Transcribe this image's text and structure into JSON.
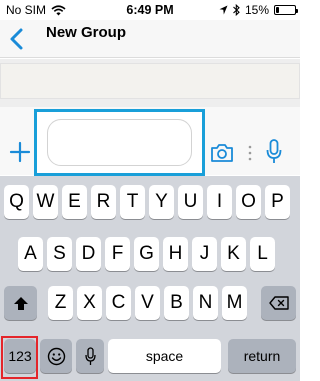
{
  "status_bar": {
    "carrier": "No SIM",
    "time": "6:49 PM",
    "battery": "15%",
    "battery_level": 0.15,
    "icons": [
      "wifi-icon",
      "location-arrow-icon",
      "bluetooth-icon",
      "battery-icon"
    ]
  },
  "nav": {
    "back_icon": "chevron-left-icon",
    "title": "New Group"
  },
  "composer": {
    "input_value": "",
    "icons": [
      "plus-icon",
      "camera-icon",
      "more-dots-icon",
      "microphone-icon"
    ]
  },
  "keyboard": {
    "row1": [
      "Q",
      "W",
      "E",
      "R",
      "T",
      "Y",
      "U",
      "I",
      "O",
      "P"
    ],
    "row2": [
      "A",
      "S",
      "D",
      "F",
      "G",
      "H",
      "J",
      "K",
      "L"
    ],
    "row3": [
      "Z",
      "X",
      "C",
      "V",
      "B",
      "N",
      "M"
    ],
    "numbers_key": "123",
    "space_key": "space",
    "return_key": "return",
    "function_icons": [
      "shift-icon",
      "backspace-icon",
      "emoji-icon",
      "dictation-mic-icon"
    ]
  },
  "colors": {
    "accent_blue": "#1a8bd8",
    "input_highlight": "#199fd9",
    "key_highlight": "#e4252a",
    "keyboard_background": "#d2d5db",
    "function_key": "#acb2bc"
  }
}
